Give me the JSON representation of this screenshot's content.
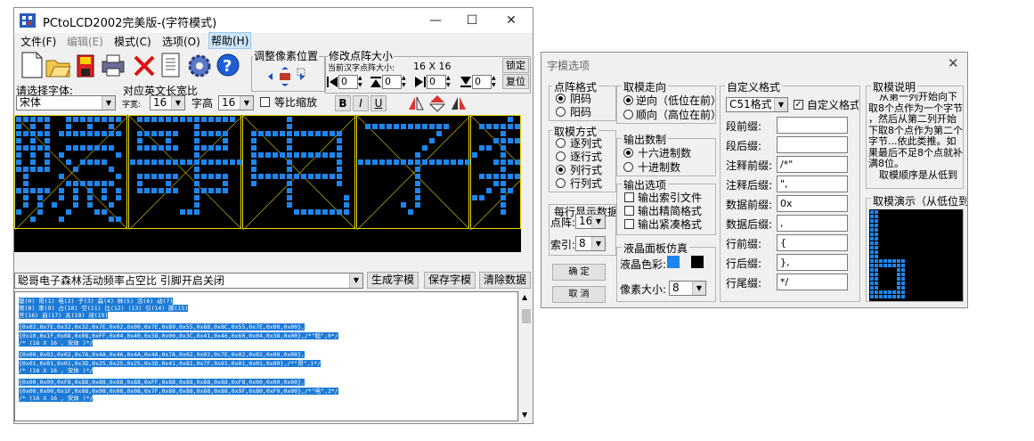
{
  "main": {
    "title": "PCtoLCD2002完美版-(字符模式)",
    "menus": [
      "文件(F)",
      "编辑(E)",
      "模式(C)",
      "选项(O)",
      "帮助(H)"
    ],
    "adjust_pos_label": "调整像素位置",
    "dot_size_label": "修改点阵大小",
    "dot_size_sub": "当前汉字点阵大小:",
    "dot_size_value": "16 X 16",
    "lock_button": "锁定",
    "reset_button": "复位",
    "spin_values": [
      "0",
      "0",
      "0",
      "0"
    ],
    "font_label": "请选择字体:",
    "ratio_label": "对应英文长宽比",
    "font_value": "宋体",
    "width_label": "字宽:",
    "width_value": "16",
    "height_label": "字高",
    "height_value": "16",
    "scale_label": "等比缩放",
    "bold": "B",
    "italic": "I",
    "underline": "U",
    "input_text": "聪哥电子森林活动频率占空比 引脚开启关闭",
    "generate_button": "生成字模",
    "save_button": "保存字模",
    "clear_button": "清除数据",
    "index_lines": [
      "聪(0) 哥(1) 电(2) 子(3) 森(4) 林(5) 活(6) 动(7)",
      "频(8) 率(9) 占(10) 空(11) 比(12)   (13) 引(14) 脚(15)",
      "开(16) 启(17) 关(18) 闭(19)"
    ],
    "code_blocks": [
      [
        "{0x02,0x7E,0x32,0x32,0x7E,0x02,0x00,0x7E,0x89,0x55,0x88,0x8C,0x55,0x7E,0x00,0x00},",
        "{0x10,0x1F,0x08,0x08,0xFF,0x04,0x40,0x38,0x00,0x3C,0x41,0x46,0x60,0x04,0x38,0x00},/*\"聪\",0*/",
        "/* (16 X 16 , 宋体 )*/"
      ],
      [
        "{0x00,0x02,0x02,0x7A,0x4A,0x4A,0x4A,0x4A,0x7A,0x02,0x02,0x7E,0x02,0x02,0x00,0x00},",
        "{0x01,0x01,0x01,0x3D,0x25,0x25,0x25,0x3D,0x41,0x81,0x7F,0x01,0x01,0x01,0x00},/*\"哥\",1*/",
        "/* (16 X 16 , 宋体 )*/"
      ],
      [
        "{0x00,0x00,0xF8,0x88,0x88,0x88,0x88,0xFF,0x88,0x88,0x88,0x88,0xF8,0x00,0x00,0x00},",
        "{0x00,0x00,0x1F,0x08,0x08,0x08,0x08,0x7F,0x88,0x88,0x88,0x88,0x9F,0x80,0xF0,0x00},/*\"电\",2*/",
        "/* (16 X 16 , 宋体 )*/"
      ]
    ]
  },
  "dialog": {
    "title": "字模选项",
    "dot_format_title": "点阵格式",
    "dot_format_options": [
      "阴码",
      "阳码"
    ],
    "take_mode_title": "取模方式",
    "take_mode_options": [
      "逐列式",
      "逐行式",
      "列行式",
      "行列式"
    ],
    "per_line_title": "每行显示数据",
    "dot_label": "点阵:",
    "dot_value": "16",
    "index_label": "索引:",
    "index_value": "8",
    "ok_button": "确   定",
    "cancel_button": "取   消",
    "direction_title": "取模走向",
    "direction_options": [
      "逆向（低位在前）",
      "顺向（高位在前）"
    ],
    "number_title": "输出数制",
    "number_options": [
      "十六进制数",
      "十进制数"
    ],
    "output_title": "输出选项",
    "output_options": [
      "输出索引文件",
      "输出精简格式",
      "输出紧凑格式"
    ],
    "lcd_title": "液晶面板仿真",
    "lcd_color_label": "液晶色彩:",
    "pixel_size_label": "像素大小:",
    "pixel_size_value": "8",
    "custom_title": "自定义格式",
    "custom_format_value": "C51格式",
    "custom_check_label": "自定义格式",
    "fields": [
      {
        "label": "段前缀:",
        "value": ""
      },
      {
        "label": "段后缀:",
        "value": ""
      },
      {
        "label": "注释前缀:",
        "value": "/*\""
      },
      {
        "label": "注释后缀:",
        "value": "\","
      },
      {
        "label": "数据前缀:",
        "value": "0x"
      },
      {
        "label": "数据后缀:",
        "value": ","
      },
      {
        "label": "行前缀:",
        "value": "{"
      },
      {
        "label": "行后缀:",
        "value": "},"
      },
      {
        "label": "行尾缀:",
        "value": "*/"
      }
    ],
    "explain_title": "取模说明",
    "explain_lines": [
      "从第一列开始向下",
      "取8个点作为一个字节",
      "，然后从第二列开始",
      "下取8个点作为第二个",
      "字节...依此类推。如",
      "果最后不足8个点就补",
      "满8位。",
      "取模顺序是从低到"
    ],
    "demo_title": "取模演示（从低位到高",
    "colors": {
      "accent_blue": "#1c86ee",
      "grid_yellow": "#e8d800",
      "selection": "#1c7bd7"
    }
  }
}
